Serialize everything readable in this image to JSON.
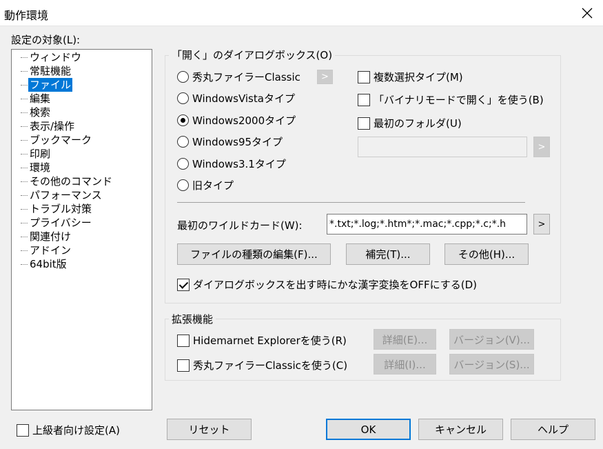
{
  "window": {
    "title": "動作環境"
  },
  "tree": {
    "label": "設定の対象(L):",
    "items": [
      "ウィンドウ",
      "常駐機能",
      "ファイル",
      "編集",
      "検索",
      "表示/操作",
      "ブックマーク",
      "印刷",
      "環境",
      "その他のコマンド",
      "パフォーマンス",
      "トラブル対策",
      "プライバシー",
      "関連付け",
      "アドイン",
      "64bit版"
    ],
    "selected": "ファイル"
  },
  "dialog_group": {
    "label": "「開く」のダイアログボックス(O)",
    "radios": [
      "秀丸ファイラーClassic",
      "WindowsVistaタイプ",
      "Windows2000タイプ",
      "Windows95タイプ",
      "Windows3.1タイプ",
      "旧タイプ"
    ],
    "selected_radio": "Windows2000タイプ",
    "checkboxes": [
      "複数選択タイプ(M)",
      "「バイナリモードで開く」を使う(B)",
      "最初のフォルダ(U)"
    ],
    "first_folder_value": "",
    "arrow": ">",
    "wildcard_label": "最初のワイルドカード(W):",
    "wildcard_value": "*.txt;*.log;*.htm*;*.mac;*.cpp;*.c;*.h",
    "btn_filetypes": "ファイルの種類の編集(F)...",
    "btn_complete": "補完(T)...",
    "btn_other": "その他(H)...",
    "ime_check": "ダイアログボックスを出す時にかな漢字変換をOFFにする(D)"
  },
  "ext_group": {
    "label": "拡張機能",
    "rows": [
      {
        "check": "Hidemarnet Explorerを使う(R)",
        "detail": "詳細(E)...",
        "version": "バージョン(V)..."
      },
      {
        "check": "秀丸ファイラーClassicを使う(C)",
        "detail": "詳細(I)...",
        "version": "バージョン(S)..."
      }
    ]
  },
  "footer": {
    "advanced": "上級者向け設定(A)",
    "reset": "リセット",
    "ok": "OK",
    "cancel": "キャンセル",
    "help": "ヘルプ"
  }
}
